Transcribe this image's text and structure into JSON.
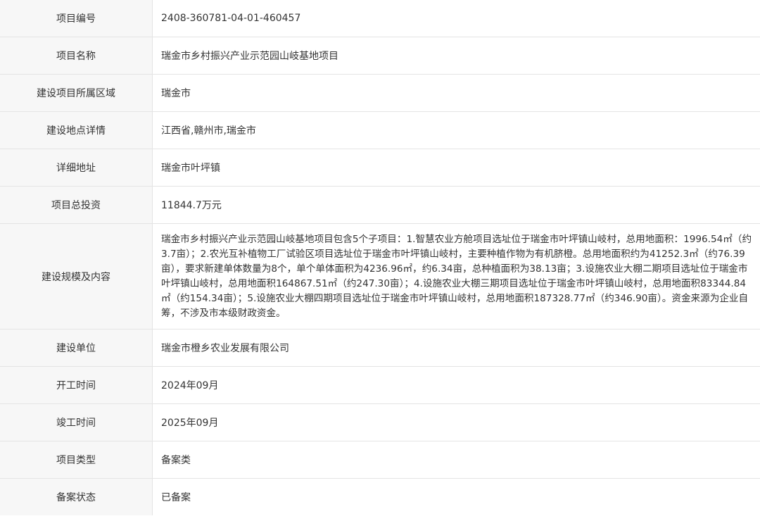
{
  "rows": [
    {
      "label": "项目编号",
      "value": "2408-360781-04-01-460457"
    },
    {
      "label": "项目名称",
      "value": "瑞金市乡村振兴产业示范园山岐基地项目"
    },
    {
      "label": "建设项目所属区域",
      "value": "瑞金市"
    },
    {
      "label": "建设地点详情",
      "value": "江西省,赣州市,瑞金市"
    },
    {
      "label": "详细地址",
      "value": "瑞金市叶坪镇"
    },
    {
      "label": "项目总投资",
      "value": "11844.7万元"
    },
    {
      "label": "建设规模及内容",
      "value": "瑞金市乡村振兴产业示范园山岐基地项目包含5个子项目：1.智慧农业方舱项目选址位于瑞金市叶坪镇山岐村，总用地面积：1996.54㎡（约3.7亩）；2.农光互补植物工厂试验区项目选址位于瑞金市叶坪镇山岐村，主要种植作物为有机脐橙。总用地面积约为41252.3㎡（约76.39亩），要求新建单体数量为8个，单个单体面积为4236.96㎡，约6.34亩，总种植面积为38.13亩；3.设施农业大棚二期项目选址位于瑞金市叶坪镇山岐村，总用地面积164867.51㎡（约247.30亩）；4.设施农业大棚三期项目选址位于瑞金市叶坪镇山岐村，总用地面积83344.84㎡（约154.34亩）；5.设施农业大棚四期项目选址位于瑞金市叶坪镇山岐村，总用地面积187328.77㎡（约346.90亩）。资金来源为企业自筹，不涉及市本级财政资金。"
    },
    {
      "label": "建设单位",
      "value": "瑞金市橙乡农业发展有限公司"
    },
    {
      "label": "开工时间",
      "value": "2024年09月"
    },
    {
      "label": "竣工时间",
      "value": "2025年09月"
    },
    {
      "label": "项目类型",
      "value": "备案类"
    },
    {
      "label": "备案状态",
      "value": "已备案"
    }
  ]
}
